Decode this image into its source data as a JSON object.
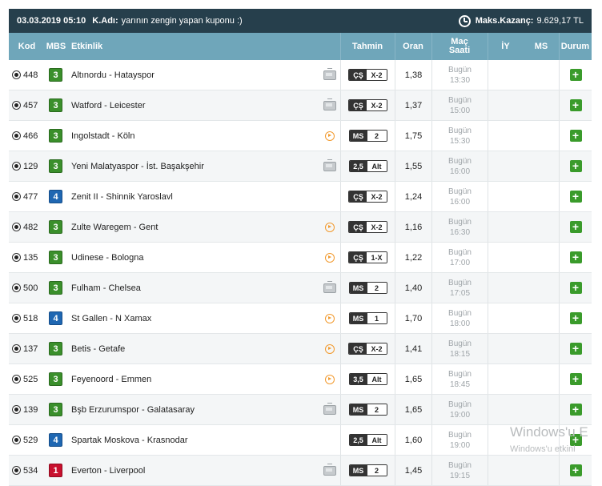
{
  "topbar": {
    "date": "03.03.2019 05:10",
    "user_label": "K.Adı:",
    "user_value": "yarının zengin yapan kuponu :)",
    "max_label": "Maks.Kazanç:",
    "max_value": "9.629,17 TL"
  },
  "header": {
    "kod": "Kod",
    "mbs": "MBS",
    "etkinlik": "Etkinlik",
    "tahmin": "Tahmin",
    "oran": "Oran",
    "mac_line1": "Maç",
    "mac_line2": "Saati",
    "iy": "İY",
    "ms": "MS",
    "durum": "Durum"
  },
  "rows": [
    {
      "kod": "448",
      "mbs": "3",
      "mbs_color": "green",
      "event": "Altınordu - Hatayspor",
      "icon": "tv-icon",
      "pick_a": "ÇŞ",
      "pick_b": "X-2",
      "odds": "1,38",
      "day": "Bugün",
      "time": "13:30"
    },
    {
      "kod": "457",
      "mbs": "3",
      "mbs_color": "green",
      "event": "Watford - Leicester",
      "icon": "tv-icon",
      "pick_a": "ÇŞ",
      "pick_b": "X-2",
      "odds": "1,37",
      "day": "Bugün",
      "time": "15:00"
    },
    {
      "kod": "466",
      "mbs": "3",
      "mbs_color": "green",
      "event": "Ingolstadt - Köln",
      "icon": "play-icon",
      "pick_a": "MS",
      "pick_b": "2",
      "odds": "1,75",
      "day": "Bugün",
      "time": "15:30"
    },
    {
      "kod": "129",
      "mbs": "3",
      "mbs_color": "green",
      "event": "Yeni Malatyaspor - İst. Başakşehir",
      "icon": "tv-icon",
      "pick_a": "2,5",
      "pick_b": "Alt",
      "odds": "1,55",
      "day": "Bugün",
      "time": "16:00"
    },
    {
      "kod": "477",
      "mbs": "4",
      "mbs_color": "blue",
      "event": "Zenit II - Shinnik Yaroslavl",
      "icon": "",
      "pick_a": "ÇŞ",
      "pick_b": "X-2",
      "odds": "1,24",
      "day": "Bugün",
      "time": "16:00"
    },
    {
      "kod": "482",
      "mbs": "3",
      "mbs_color": "green",
      "event": "Zulte Waregem - Gent",
      "icon": "play-icon",
      "pick_a": "ÇŞ",
      "pick_b": "X-2",
      "odds": "1,16",
      "day": "Bugün",
      "time": "16:30"
    },
    {
      "kod": "135",
      "mbs": "3",
      "mbs_color": "green",
      "event": "Udinese - Bologna",
      "icon": "play-icon",
      "pick_a": "ÇŞ",
      "pick_b": "1-X",
      "odds": "1,22",
      "day": "Bugün",
      "time": "17:00"
    },
    {
      "kod": "500",
      "mbs": "3",
      "mbs_color": "green",
      "event": "Fulham - Chelsea",
      "icon": "tv-icon",
      "pick_a": "MS",
      "pick_b": "2",
      "odds": "1,40",
      "day": "Bugün",
      "time": "17:05"
    },
    {
      "kod": "518",
      "mbs": "4",
      "mbs_color": "blue",
      "event": "St Gallen - N Xamax",
      "icon": "play-icon",
      "pick_a": "MS",
      "pick_b": "1",
      "odds": "1,70",
      "day": "Bugün",
      "time": "18:00"
    },
    {
      "kod": "137",
      "mbs": "3",
      "mbs_color": "green",
      "event": "Betis - Getafe",
      "icon": "play-icon",
      "pick_a": "ÇŞ",
      "pick_b": "X-2",
      "odds": "1,41",
      "day": "Bugün",
      "time": "18:15"
    },
    {
      "kod": "525",
      "mbs": "3",
      "mbs_color": "green",
      "event": "Feyenoord - Emmen",
      "icon": "play-icon",
      "pick_a": "3,5",
      "pick_b": "Alt",
      "odds": "1,65",
      "day": "Bugün",
      "time": "18:45"
    },
    {
      "kod": "139",
      "mbs": "3",
      "mbs_color": "green",
      "event": "Bşb Erzurumspor - Galatasaray",
      "icon": "tv-icon",
      "pick_a": "MS",
      "pick_b": "2",
      "odds": "1,65",
      "day": "Bugün",
      "time": "19:00"
    },
    {
      "kod": "529",
      "mbs": "4",
      "mbs_color": "blue",
      "event": "Spartak Moskova - Krasnodar",
      "icon": "",
      "pick_a": "2,5",
      "pick_b": "Alt",
      "odds": "1,60",
      "day": "Bugün",
      "time": "19:00"
    },
    {
      "kod": "534",
      "mbs": "1",
      "mbs_color": "red",
      "event": "Everton - Liverpool",
      "icon": "tv-icon",
      "pick_a": "MS",
      "pick_b": "2",
      "odds": "1,45",
      "day": "Bugün",
      "time": "19:15"
    }
  ],
  "add_button_label": "+",
  "watermark": {
    "line1": "Windows'u E",
    "line2": "Windows'u etkinl"
  }
}
